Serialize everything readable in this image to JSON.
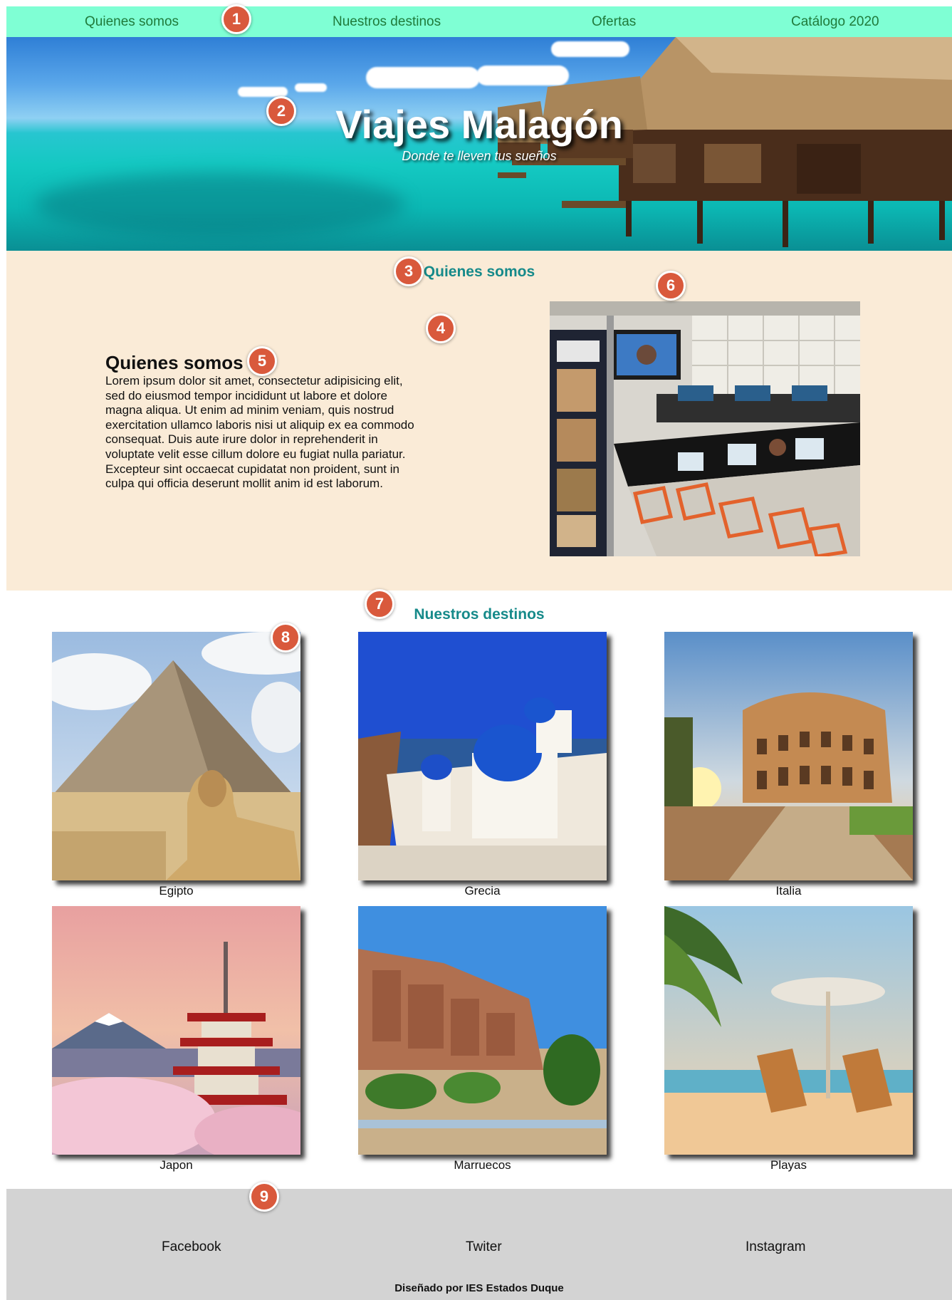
{
  "nav": {
    "items": [
      {
        "label": "Quienes somos"
      },
      {
        "label": "Nuestros destinos"
      },
      {
        "label": "Ofertas"
      },
      {
        "label": "Catálogo 2020"
      }
    ]
  },
  "hero": {
    "title": "Viajes Malagón",
    "subtitle": "Donde te lleven tus sueños"
  },
  "about": {
    "section_title": "Quienes somos",
    "heading": "Quienes somos",
    "text": "Lorem ipsum dolor sit amet, consectetur adipisicing elit, sed do eiusmod tempor incididunt ut labore et dolore magna aliqua. Ut enim ad minim veniam, quis nostrud exercitation ullamco laboris nisi ut aliquip ex ea commodo consequat. Duis aute irure dolor in reprehenderit in voluptate velit esse cillum dolore eu fugiat nulla pariatur. Excepteur sint occaecat cupidatat non proident, sunt in culpa qui officia deserunt mollit anim id est laborum."
  },
  "destinations": {
    "section_title": "Nuestros destinos",
    "items": [
      {
        "label": "Egipto"
      },
      {
        "label": "Grecia"
      },
      {
        "label": "Italia"
      },
      {
        "label": "Japon"
      },
      {
        "label": "Marruecos"
      },
      {
        "label": "Playas"
      }
    ]
  },
  "footer": {
    "links": [
      {
        "label": "Facebook"
      },
      {
        "label": "Twiter"
      },
      {
        "label": "Instagram"
      }
    ],
    "credit": "Diseñado por IES Estados Duque"
  },
  "markers": [
    "1",
    "2",
    "3",
    "4",
    "5",
    "6",
    "7",
    "8",
    "9"
  ],
  "colors": {
    "nav_bg": "#7fffd4",
    "nav_link": "#1f7a3a",
    "about_bg": "#faebd7",
    "section_title": "#168a8a",
    "footer_bg": "#d3d3d3",
    "marker": "#d9593c"
  }
}
